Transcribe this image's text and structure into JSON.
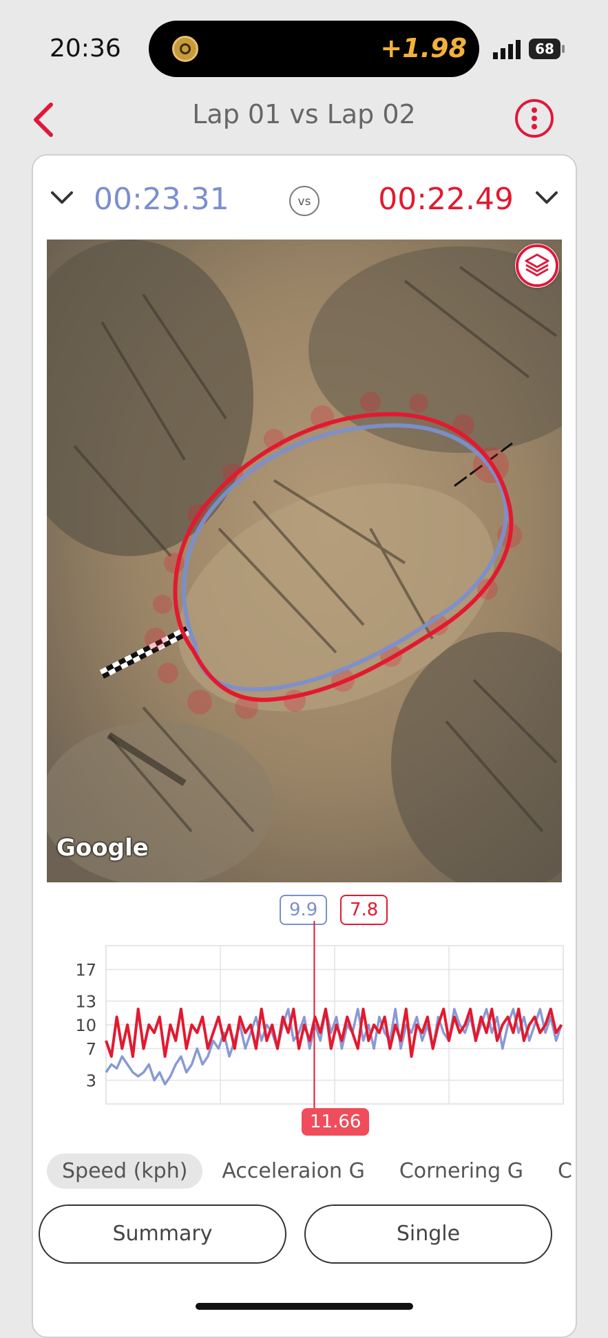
{
  "status_bar": {
    "time": "20:36",
    "ticker_value": "+1.98",
    "battery": "68"
  },
  "nav": {
    "title": "Lap 01 vs Lap 02"
  },
  "comparison": {
    "lap_a_time": "00:23.31",
    "vs_label": "vs",
    "lap_b_time": "00:22.49"
  },
  "map": {
    "attribution": "Google"
  },
  "colors": {
    "lap_a": "#7b8fcf",
    "lap_b": "#e3192f",
    "accent": "#e0173a"
  },
  "icons": {
    "back": "chevron-left-icon",
    "more": "more-vertical-icon",
    "layers": "layers-icon",
    "expand": "chevron-down-icon"
  },
  "chart_cursor": {
    "lap_a_value": "9.9",
    "lap_b_value": "7.8",
    "time_value": "11.66"
  },
  "chart_data": {
    "type": "line",
    "ylabel": "",
    "xlabel": "",
    "y_ticks": [
      "17",
      "13",
      "10",
      "7",
      "3"
    ],
    "x_ticks": [
      "00.0",
      "06.4",
      "12.8",
      "19.2"
    ],
    "xlim": [
      0,
      25.6
    ],
    "ylim": [
      0,
      20
    ],
    "grid": true,
    "series": [
      {
        "name": "Lap 01",
        "x": [
          0,
          0.3,
          0.6,
          0.9,
          1.2,
          1.5,
          1.8,
          2.1,
          2.4,
          2.7,
          3.0,
          3.3,
          3.6,
          3.9,
          4.2,
          4.5,
          4.8,
          5.1,
          5.4,
          5.7,
          6.0,
          6.3,
          6.6,
          6.9,
          7.2,
          7.5,
          7.8,
          8.1,
          8.4,
          8.7,
          9.0,
          9.3,
          9.6,
          9.9,
          10.2,
          10.5,
          10.8,
          11.1,
          11.4,
          11.7,
          12.0,
          12.3,
          12.6,
          12.9,
          13.2,
          13.5,
          13.8,
          14.1,
          14.4,
          14.7,
          15.0,
          15.3,
          15.6,
          15.9,
          16.2,
          16.5,
          16.8,
          17.1,
          17.4,
          17.7,
          18.0,
          18.3,
          18.6,
          18.9,
          19.2,
          19.5,
          19.8,
          20.1,
          20.4,
          20.7,
          21.0,
          21.3,
          21.6,
          21.9,
          22.2,
          22.5,
          22.8,
          23.1,
          23.4,
          23.7,
          24.0,
          24.3,
          24.6,
          24.9,
          25.2,
          25.5
        ],
        "values": [
          4,
          5,
          4.5,
          6,
          5,
          4,
          3.5,
          4,
          5,
          3,
          4,
          2.5,
          3.5,
          5,
          6,
          4,
          5,
          7,
          5,
          6,
          8,
          7,
          9,
          6,
          8,
          10,
          7,
          9,
          11,
          8,
          10,
          9,
          7,
          10,
          12,
          8,
          9,
          11,
          7,
          10,
          8,
          12,
          9,
          11,
          7,
          10,
          9,
          12,
          8,
          10,
          7,
          11,
          9,
          8,
          12,
          7,
          10,
          9,
          11,
          8,
          10,
          7,
          11,
          9,
          8,
          12,
          10,
          9,
          11,
          8,
          10,
          12,
          9,
          11,
          7,
          10,
          12,
          9,
          11,
          8,
          10,
          12,
          9,
          11,
          8,
          10
        ]
      },
      {
        "name": "Lap 02",
        "x": [
          0,
          0.3,
          0.6,
          0.9,
          1.2,
          1.5,
          1.8,
          2.1,
          2.4,
          2.7,
          3.0,
          3.3,
          3.6,
          3.9,
          4.2,
          4.5,
          4.8,
          5.1,
          5.4,
          5.7,
          6.0,
          6.3,
          6.6,
          6.9,
          7.2,
          7.5,
          7.8,
          8.1,
          8.4,
          8.7,
          9.0,
          9.3,
          9.6,
          9.9,
          10.2,
          10.5,
          10.8,
          11.1,
          11.4,
          11.7,
          12.0,
          12.3,
          12.6,
          12.9,
          13.2,
          13.5,
          13.8,
          14.1,
          14.4,
          14.7,
          15.0,
          15.3,
          15.6,
          15.9,
          16.2,
          16.5,
          16.8,
          17.1,
          17.4,
          17.7,
          18.0,
          18.3,
          18.6,
          18.9,
          19.2,
          19.5,
          19.8,
          20.1,
          20.4,
          20.7,
          21.0,
          21.3,
          21.6,
          21.9,
          22.2,
          22.5,
          22.8,
          23.1,
          23.4,
          23.7,
          24.0,
          24.3,
          24.6,
          24.9,
          25.2,
          25.5
        ],
        "values": [
          8,
          6,
          11,
          7,
          10,
          6,
          12,
          7,
          10,
          9,
          11,
          6,
          10,
          8,
          12,
          7,
          10,
          9,
          11,
          7,
          9,
          11,
          8,
          10,
          7,
          11,
          9,
          10,
          7,
          12,
          8,
          10,
          7,
          11,
          9,
          12,
          7,
          10,
          8,
          11,
          9,
          12,
          7,
          10,
          8,
          11,
          9,
          7,
          12,
          8,
          10,
          9,
          11,
          7,
          10,
          8,
          12,
          6,
          10,
          9,
          11,
          7,
          10,
          12,
          8,
          11,
          9,
          10,
          12,
          8,
          11,
          9,
          12,
          8,
          10,
          11,
          9,
          12,
          8,
          10,
          11,
          9,
          10,
          12,
          9,
          10
        ]
      }
    ]
  },
  "tabs": [
    "Speed (kph)",
    "Acceleraion G",
    "Cornering G",
    "C"
  ],
  "buttons": {
    "summary": "Summary",
    "single": "Single"
  }
}
